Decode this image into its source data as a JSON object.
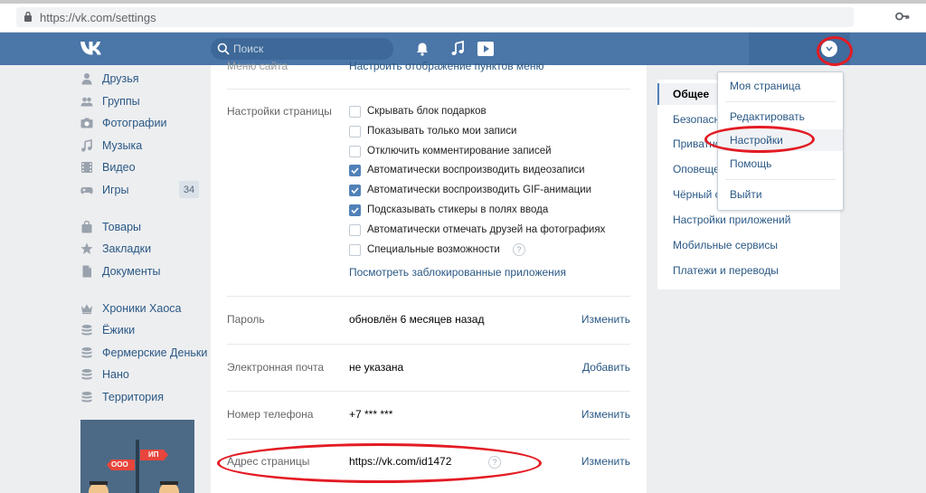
{
  "browser": {
    "url": "https://vk.com/settings",
    "icons": {
      "lock": "lock-icon",
      "key": "key-icon"
    }
  },
  "header": {
    "logo": "VK",
    "search_placeholder": "Поиск",
    "icons": {
      "search": "search-icon",
      "notifications": "bell-icon",
      "music": "music-icon",
      "video": "play-icon",
      "menu": "chevron-down-icon"
    },
    "accent": "#4a76a8"
  },
  "sidebar": {
    "items": [
      {
        "label": "Друзья",
        "icon": "person-icon"
      },
      {
        "label": "Группы",
        "icon": "people-icon"
      },
      {
        "label": "Фотографии",
        "icon": "camera-icon"
      },
      {
        "label": "Музыка",
        "icon": "music-note-icon"
      },
      {
        "label": "Видео",
        "icon": "film-icon"
      },
      {
        "label": "Игры",
        "icon": "gamepad-icon",
        "badge": "34"
      },
      {
        "label": "Товары",
        "icon": "bag-icon"
      },
      {
        "label": "Закладки",
        "icon": "star-icon"
      },
      {
        "label": "Документы",
        "icon": "document-icon"
      },
      {
        "label": "Хроники Хаоса",
        "icon": "crown-icon"
      },
      {
        "label": "Ёжики",
        "icon": "stack-icon"
      },
      {
        "label": "Фермерские Деньки",
        "icon": "stack-icon"
      },
      {
        "label": "Нано",
        "icon": "stack-icon"
      },
      {
        "label": "Территория",
        "icon": "stack-icon"
      }
    ],
    "ad": {
      "label_left": "ООО",
      "label_right": "ИП"
    }
  },
  "settings": {
    "top_cutoff_label": "Меню сайта",
    "top_cutoff_value": "Настроить отображение пунктов меню",
    "page_settings": {
      "label": "Настройки страницы",
      "options": [
        {
          "label": "Скрывать блок подарков",
          "checked": false
        },
        {
          "label": "Показывать только мои записи",
          "checked": false
        },
        {
          "label": "Отключить комментирование записей",
          "checked": false
        },
        {
          "label": "Автоматически воспроизводить видеозаписи",
          "checked": true
        },
        {
          "label": "Автоматически воспроизводить GIF-анимации",
          "checked": true
        },
        {
          "label": "Подсказывать стикеры в полях ввода",
          "checked": true
        },
        {
          "label": "Автоматически отмечать друзей на фотографиях",
          "checked": false
        },
        {
          "label": "Специальные возможности",
          "checked": false
        }
      ],
      "blocked_apps_link": "Посмотреть заблокированные приложения"
    },
    "password": {
      "label": "Пароль",
      "value": "обновлён 6 месяцев назад",
      "action": "Изменить"
    },
    "email": {
      "label": "Электронная почта",
      "value": "не указана",
      "action": "Добавить"
    },
    "phone": {
      "label": "Номер телефона",
      "value": "+7 *** ***",
      "action": "Изменить"
    },
    "address": {
      "label": "Адрес страницы",
      "value": "https://vk.com/id1472",
      "action": "Изменить"
    }
  },
  "right_nav": {
    "items": [
      {
        "label": "Общее",
        "active": true
      },
      {
        "label": "Безопасность",
        "active": false
      },
      {
        "label": "Приватность",
        "active": false
      },
      {
        "label": "Оповещения",
        "active": false
      },
      {
        "label": "Чёрный список",
        "active": false
      },
      {
        "label": "Настройки приложений",
        "active": false
      },
      {
        "label": "Мобильные сервисы",
        "active": false
      },
      {
        "label": "Платежи и переводы",
        "active": false
      }
    ]
  },
  "dropdown": {
    "items": [
      {
        "label": "Моя страница"
      },
      {
        "label": "Редактировать"
      },
      {
        "label": "Настройки",
        "highlight": true
      },
      {
        "label": "Помощь"
      },
      {
        "label": "Выйти"
      }
    ]
  },
  "colors": {
    "link": "#2a5885",
    "checkbox_checked": "#5181b8",
    "annotation": "#e31b23",
    "background": "#edeef0"
  }
}
